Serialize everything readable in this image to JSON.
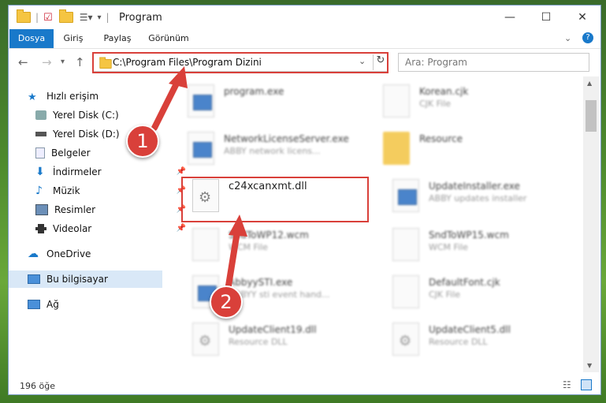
{
  "window": {
    "title": "Program",
    "minimize": "—",
    "maximize": "☐",
    "close": "✕"
  },
  "ribbon": {
    "tabs": [
      "Dosya",
      "Giriş",
      "Paylaş",
      "Görünüm"
    ]
  },
  "address": {
    "path": "C:\\Program Files\\Program Dizini",
    "search_placeholder": "Ara: Program"
  },
  "nav": {
    "items": [
      {
        "label": "Hızlı erişim"
      },
      {
        "label": "Yerel Disk (C:)"
      },
      {
        "label": "Yerel Disk (D:)"
      },
      {
        "label": "Belgeler"
      },
      {
        "label": "İndirmeler"
      },
      {
        "label": "Müzik"
      },
      {
        "label": "Resimler"
      },
      {
        "label": "Videolar"
      },
      {
        "label": "OneDrive"
      },
      {
        "label": "Bu bilgisayar"
      },
      {
        "label": "Ağ"
      }
    ]
  },
  "files": [
    {
      "name": "program.exe",
      "desc": "",
      "type": "exe"
    },
    {
      "name": "Korean.cjk",
      "desc": "CJK File",
      "type": "file"
    },
    {
      "name": "NetworkLicenseServer.exe",
      "desc": "ABBY network licens...",
      "type": "exe"
    },
    {
      "name": "Resource",
      "desc": "",
      "type": "folder"
    },
    {
      "name": "c24xcanxmt.dll",
      "desc": "",
      "type": "dll"
    },
    {
      "name": "UpdateInstaller.exe",
      "desc": "ABBY updates installer",
      "type": "exe"
    },
    {
      "name": "SndToWP12.wcm",
      "desc": "WCM File",
      "type": "file"
    },
    {
      "name": "SndToWP15.wcm",
      "desc": "WCM File",
      "type": "file"
    },
    {
      "name": "AbbyySTI.exe",
      "desc": "ABBYY sti event hand...",
      "type": "exe"
    },
    {
      "name": "DefaultFont.cjk",
      "desc": "CJK File",
      "type": "file"
    },
    {
      "name": "UpdateClient19.dll",
      "desc": "Resource DLL",
      "type": "dll"
    },
    {
      "name": "UpdateClient5.dll",
      "desc": "Resource DLL",
      "type": "dll"
    }
  ],
  "status": {
    "count": "196 öğe"
  },
  "annotations": {
    "badge1": "1",
    "badge2": "2"
  },
  "colors": {
    "accent": "#1979ca",
    "highlight": "#d9403a"
  }
}
